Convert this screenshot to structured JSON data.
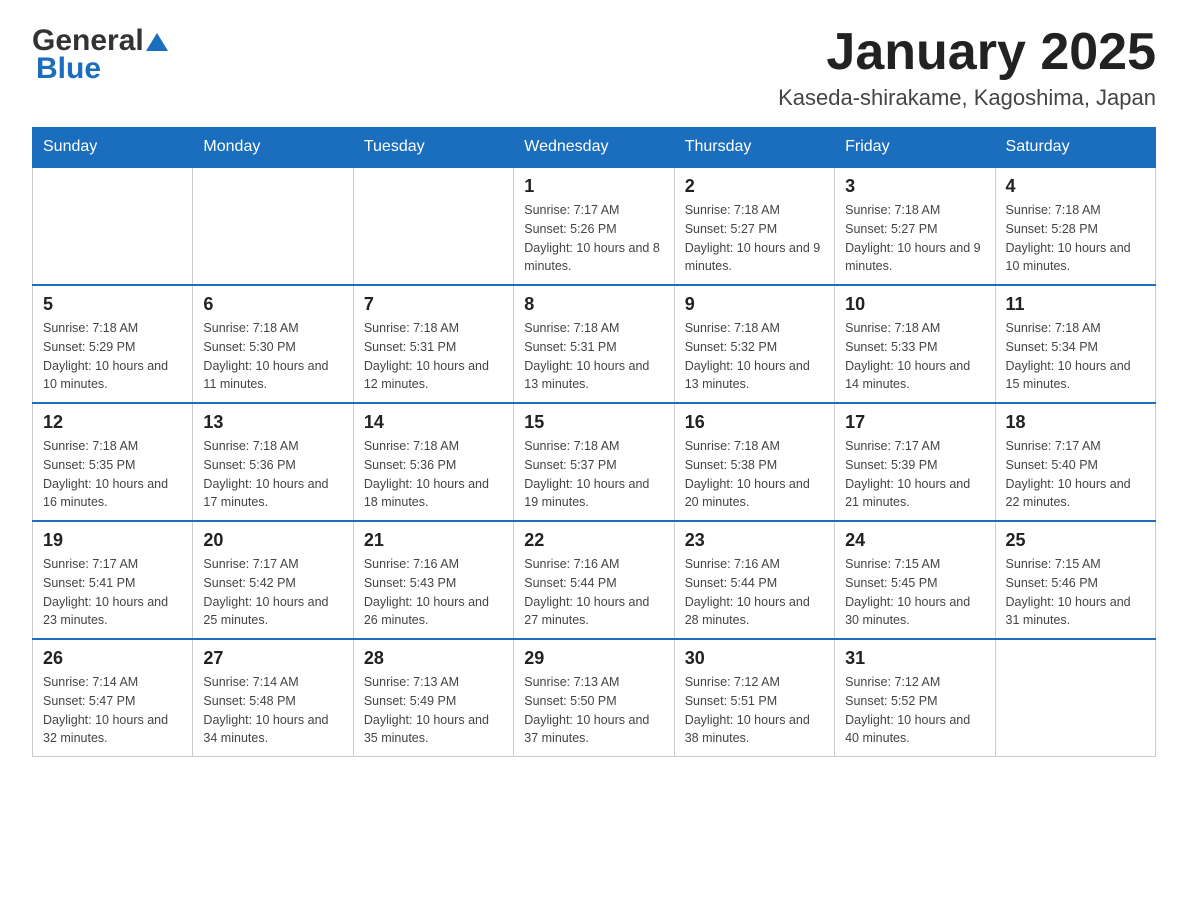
{
  "header": {
    "logo_general": "General",
    "logo_blue": "Blue",
    "month_title": "January 2025",
    "location": "Kaseda-shirakame, Kagoshima, Japan"
  },
  "weekdays": [
    "Sunday",
    "Monday",
    "Tuesday",
    "Wednesday",
    "Thursday",
    "Friday",
    "Saturday"
  ],
  "weeks": [
    [
      {
        "day": "",
        "info": ""
      },
      {
        "day": "",
        "info": ""
      },
      {
        "day": "",
        "info": ""
      },
      {
        "day": "1",
        "info": "Sunrise: 7:17 AM\nSunset: 5:26 PM\nDaylight: 10 hours and 8 minutes."
      },
      {
        "day": "2",
        "info": "Sunrise: 7:18 AM\nSunset: 5:27 PM\nDaylight: 10 hours and 9 minutes."
      },
      {
        "day": "3",
        "info": "Sunrise: 7:18 AM\nSunset: 5:27 PM\nDaylight: 10 hours and 9 minutes."
      },
      {
        "day": "4",
        "info": "Sunrise: 7:18 AM\nSunset: 5:28 PM\nDaylight: 10 hours and 10 minutes."
      }
    ],
    [
      {
        "day": "5",
        "info": "Sunrise: 7:18 AM\nSunset: 5:29 PM\nDaylight: 10 hours and 10 minutes."
      },
      {
        "day": "6",
        "info": "Sunrise: 7:18 AM\nSunset: 5:30 PM\nDaylight: 10 hours and 11 minutes."
      },
      {
        "day": "7",
        "info": "Sunrise: 7:18 AM\nSunset: 5:31 PM\nDaylight: 10 hours and 12 minutes."
      },
      {
        "day": "8",
        "info": "Sunrise: 7:18 AM\nSunset: 5:31 PM\nDaylight: 10 hours and 13 minutes."
      },
      {
        "day": "9",
        "info": "Sunrise: 7:18 AM\nSunset: 5:32 PM\nDaylight: 10 hours and 13 minutes."
      },
      {
        "day": "10",
        "info": "Sunrise: 7:18 AM\nSunset: 5:33 PM\nDaylight: 10 hours and 14 minutes."
      },
      {
        "day": "11",
        "info": "Sunrise: 7:18 AM\nSunset: 5:34 PM\nDaylight: 10 hours and 15 minutes."
      }
    ],
    [
      {
        "day": "12",
        "info": "Sunrise: 7:18 AM\nSunset: 5:35 PM\nDaylight: 10 hours and 16 minutes."
      },
      {
        "day": "13",
        "info": "Sunrise: 7:18 AM\nSunset: 5:36 PM\nDaylight: 10 hours and 17 minutes."
      },
      {
        "day": "14",
        "info": "Sunrise: 7:18 AM\nSunset: 5:36 PM\nDaylight: 10 hours and 18 minutes."
      },
      {
        "day": "15",
        "info": "Sunrise: 7:18 AM\nSunset: 5:37 PM\nDaylight: 10 hours and 19 minutes."
      },
      {
        "day": "16",
        "info": "Sunrise: 7:18 AM\nSunset: 5:38 PM\nDaylight: 10 hours and 20 minutes."
      },
      {
        "day": "17",
        "info": "Sunrise: 7:17 AM\nSunset: 5:39 PM\nDaylight: 10 hours and 21 minutes."
      },
      {
        "day": "18",
        "info": "Sunrise: 7:17 AM\nSunset: 5:40 PM\nDaylight: 10 hours and 22 minutes."
      }
    ],
    [
      {
        "day": "19",
        "info": "Sunrise: 7:17 AM\nSunset: 5:41 PM\nDaylight: 10 hours and 23 minutes."
      },
      {
        "day": "20",
        "info": "Sunrise: 7:17 AM\nSunset: 5:42 PM\nDaylight: 10 hours and 25 minutes."
      },
      {
        "day": "21",
        "info": "Sunrise: 7:16 AM\nSunset: 5:43 PM\nDaylight: 10 hours and 26 minutes."
      },
      {
        "day": "22",
        "info": "Sunrise: 7:16 AM\nSunset: 5:44 PM\nDaylight: 10 hours and 27 minutes."
      },
      {
        "day": "23",
        "info": "Sunrise: 7:16 AM\nSunset: 5:44 PM\nDaylight: 10 hours and 28 minutes."
      },
      {
        "day": "24",
        "info": "Sunrise: 7:15 AM\nSunset: 5:45 PM\nDaylight: 10 hours and 30 minutes."
      },
      {
        "day": "25",
        "info": "Sunrise: 7:15 AM\nSunset: 5:46 PM\nDaylight: 10 hours and 31 minutes."
      }
    ],
    [
      {
        "day": "26",
        "info": "Sunrise: 7:14 AM\nSunset: 5:47 PM\nDaylight: 10 hours and 32 minutes."
      },
      {
        "day": "27",
        "info": "Sunrise: 7:14 AM\nSunset: 5:48 PM\nDaylight: 10 hours and 34 minutes."
      },
      {
        "day": "28",
        "info": "Sunrise: 7:13 AM\nSunset: 5:49 PM\nDaylight: 10 hours and 35 minutes."
      },
      {
        "day": "29",
        "info": "Sunrise: 7:13 AM\nSunset: 5:50 PM\nDaylight: 10 hours and 37 minutes."
      },
      {
        "day": "30",
        "info": "Sunrise: 7:12 AM\nSunset: 5:51 PM\nDaylight: 10 hours and 38 minutes."
      },
      {
        "day": "31",
        "info": "Sunrise: 7:12 AM\nSunset: 5:52 PM\nDaylight: 10 hours and 40 minutes."
      },
      {
        "day": "",
        "info": ""
      }
    ]
  ]
}
